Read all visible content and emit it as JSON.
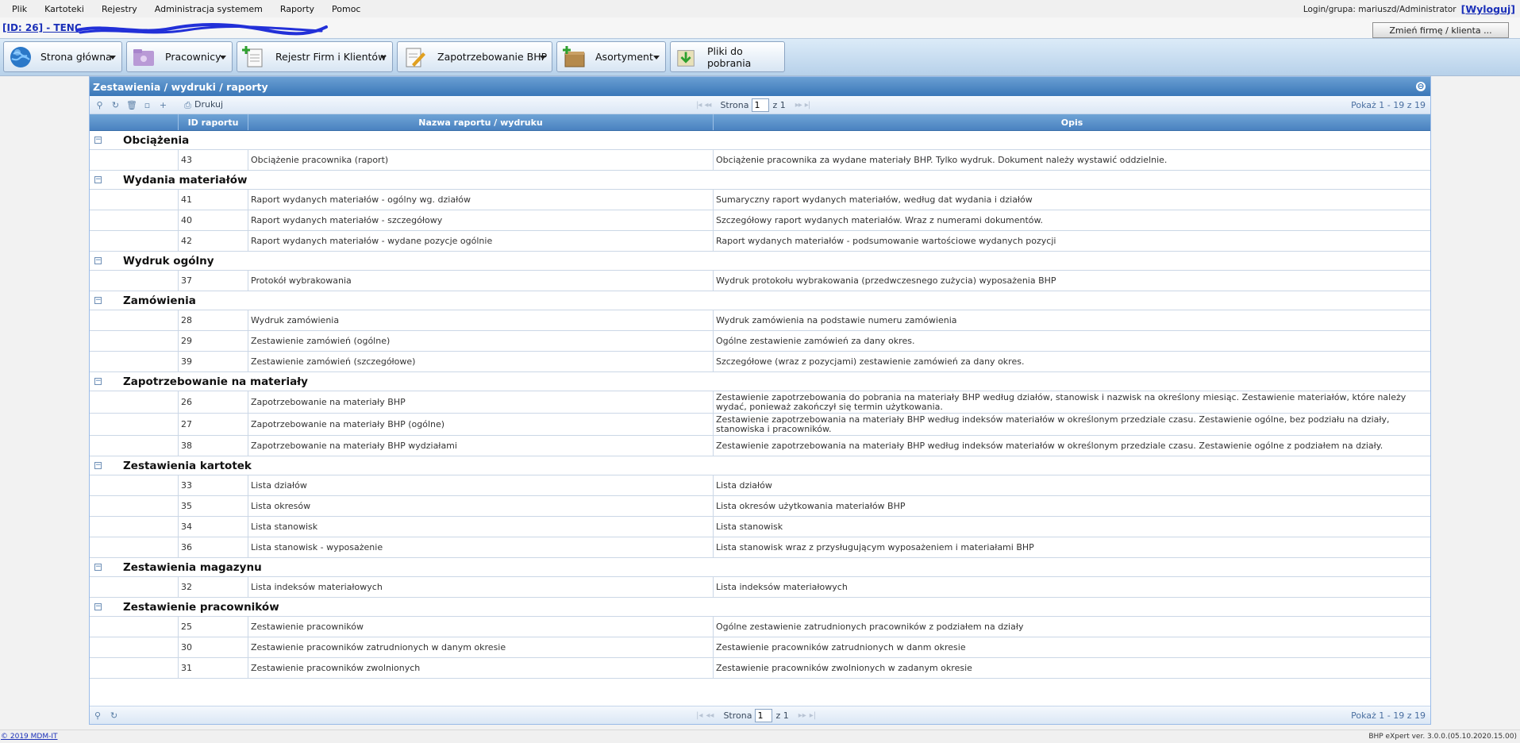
{
  "menu": {
    "items": [
      "Plik",
      "Kartoteki",
      "Rejestry",
      "Administracja systemem",
      "Raporty",
      "Pomoc"
    ],
    "login_text": "Login/grupa: mariuszd/Administrator",
    "logout_label": "[Wyloguj]"
  },
  "idbar": {
    "title": "[ID: 26] - TENC",
    "change_button": "Zmień firmę / klienta ..."
  },
  "toolbar": {
    "buttons": [
      {
        "label": "Strona główna",
        "icon": "globe-icon"
      },
      {
        "label": "Pracownicy",
        "icon": "folder-icon"
      },
      {
        "label": "Rejestr Firm i Klientów",
        "icon": "document-add-icon"
      },
      {
        "label": "Zapotrzebowanie BHP",
        "icon": "edit-document-icon"
      },
      {
        "label": "Asortyment",
        "icon": "box-add-icon"
      },
      {
        "label": "Pliki do pobrania",
        "icon": "download-icon"
      }
    ]
  },
  "panel": {
    "title": "Zestawienia / wydruki / raporty",
    "print_label": "Drukuj",
    "page_label": "Strona",
    "page_value": "1",
    "of_label": "z 1",
    "summary": "Pokaż 1 - 19 z 19"
  },
  "grid": {
    "columns": [
      "ID raportu",
      "Nazwa raportu / wydruku",
      "Opis"
    ],
    "groups": [
      {
        "title": "Obciążenia",
        "rows": [
          {
            "id": "43",
            "name": "Obciążenie pracownika (raport)",
            "desc": "Obciążenie pracownika za wydane materiały BHP. Tylko wydruk. Dokument należy wystawić oddzielnie."
          }
        ]
      },
      {
        "title": "Wydania materiałów",
        "rows": [
          {
            "id": "41",
            "name": "Raport wydanych materiałów - ogólny wg. działów",
            "desc": "Sumaryczny raport wydanych materiałów, według dat wydania i działów"
          },
          {
            "id": "40",
            "name": "Raport wydanych materiałów - szczegółowy",
            "desc": "Szczegółowy raport wydanych materiałów. Wraz z numerami dokumentów."
          },
          {
            "id": "42",
            "name": "Raport wydanych materiałów - wydane pozycje ogólnie",
            "desc": "Raport wydanych materiałów - podsumowanie wartościowe wydanych pozycji"
          }
        ]
      },
      {
        "title": "Wydruk ogólny",
        "rows": [
          {
            "id": "37",
            "name": "Protokół wybrakowania",
            "desc": "Wydruk protokołu wybrakowania (przedwczesnego zużycia) wyposażenia BHP"
          }
        ]
      },
      {
        "title": "Zamówienia",
        "rows": [
          {
            "id": "28",
            "name": "Wydruk zamówienia",
            "desc": "Wydruk zamówienia na podstawie numeru zamówienia"
          },
          {
            "id": "29",
            "name": "Zestawienie zamówień (ogólne)",
            "desc": "Ogólne zestawienie zamówień za dany okres."
          },
          {
            "id": "39",
            "name": "Zestawienie zamówień (szczegółowe)",
            "desc": "Szczegółowe (wraz z pozycjami) zestawienie zamówień za dany okres."
          }
        ]
      },
      {
        "title": "Zapotrzebowanie na materiały",
        "rows": [
          {
            "id": "26",
            "name": "Zapotrzebowanie na materiały BHP",
            "desc": "Zestawienie zapotrzebowania do pobrania na materiały BHP według działów, stanowisk i nazwisk na określony miesiąc. Zestawienie materiałów, które należy wydać, ponieważ zakończył się termin użytkowania.",
            "tall": true
          },
          {
            "id": "27",
            "name": "Zapotrzebowanie na materiały BHP (ogólne)",
            "desc": "Zestawienie zapotrzebowania na materiały BHP według indeksów materiałów w określonym przedziale czasu. Zestawienie ogólne, bez podziału na działy, stanowiska i pracowników.",
            "tall": true
          },
          {
            "id": "38",
            "name": "Zapotrzebowanie na materiały BHP wydziałami",
            "desc": "Zestawienie zapotrzebowania na materiały BHP według indeksów materiałów w określonym przedziale czasu. Zestawienie ogólne z podziałem na działy."
          }
        ]
      },
      {
        "title": "Zestawienia kartotek",
        "rows": [
          {
            "id": "33",
            "name": "Lista działów",
            "desc": "Lista działów"
          },
          {
            "id": "35",
            "name": "Lista okresów",
            "desc": "Lista okresów użytkowania materiałów BHP"
          },
          {
            "id": "34",
            "name": "Lista stanowisk",
            "desc": "Lista stanowisk"
          },
          {
            "id": "36",
            "name": "Lista stanowisk - wyposażenie",
            "desc": "Lista stanowisk wraz z przysługującym wyposażeniem i materiałami BHP"
          }
        ]
      },
      {
        "title": "Zestawienia magazynu",
        "rows": [
          {
            "id": "32",
            "name": "Lista indeksów materiałowych",
            "desc": "Lista indeksów materiałowych"
          }
        ]
      },
      {
        "title": "Zestawienie pracowników",
        "rows": [
          {
            "id": "25",
            "name": "Zestawienie pracowników",
            "desc": "Ogólne zestawienie zatrudnionych pracowników z podziałem na działy"
          },
          {
            "id": "30",
            "name": "Zestawienie pracowników zatrudnionych w danym okresie",
            "desc": "Zestawienie pracowników zatrudnionych w danm okresie"
          },
          {
            "id": "31",
            "name": "Zestawienie pracowników zwolnionych",
            "desc": "Zestawienie pracowników zwolnionych w zadanym okresie"
          }
        ]
      }
    ]
  },
  "footer": {
    "copyright": "© 2019 MDM-IT",
    "version": "BHP eXpert ver. 3.0.0.(05.10.2020.15.00)"
  },
  "colors": {
    "header_blue": "#4a82c0",
    "link_blue": "#1a2fb8",
    "toolbar_bg": "#c9ddf1"
  }
}
